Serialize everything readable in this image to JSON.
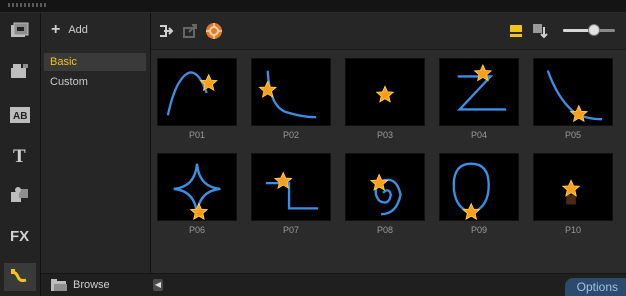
{
  "categories_panel": {
    "add_label": "Add",
    "items": [
      {
        "label": "Basic",
        "selected": true
      },
      {
        "label": "Custom",
        "selected": false
      }
    ],
    "browse_label": "Browse"
  },
  "left_toolbar": [
    {
      "icon": "media-icon"
    },
    {
      "icon": "instant-project-icon"
    },
    {
      "icon": "transition-icon"
    },
    {
      "icon": "title-icon"
    },
    {
      "icon": "graphic-icon"
    },
    {
      "icon": "filter-icon"
    },
    {
      "icon": "path-icon",
      "active": true
    }
  ],
  "toolbar": {
    "zoom_fraction": 0.6,
    "buttons": [
      {
        "icon": "import-path-icon"
      },
      {
        "icon": "export-path-icon"
      },
      {
        "icon": "path-settings-icon"
      },
      {
        "icon": "list-view-icon"
      },
      {
        "icon": "sort-icon"
      }
    ]
  },
  "paths": [
    {
      "label": "P01"
    },
    {
      "label": "P02"
    },
    {
      "label": "P03"
    },
    {
      "label": "P04"
    },
    {
      "label": "P05"
    },
    {
      "label": "P06"
    },
    {
      "label": "P07"
    },
    {
      "label": "P08"
    },
    {
      "label": "P09"
    },
    {
      "label": "P10"
    }
  ],
  "footer": {
    "scroll_left_glyph": "◀",
    "options_label": "Options"
  },
  "colors": {
    "accent": "#f2c31b",
    "path_line": "#3a8fe6",
    "star": "#ff9d1c"
  }
}
